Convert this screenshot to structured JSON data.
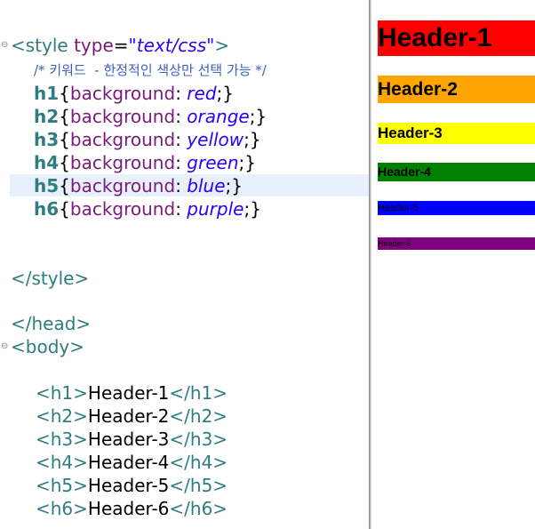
{
  "editor": {
    "style_open_tag": "style",
    "style_attr_name": "type",
    "style_attr_value": "\"text/css\"",
    "comment": "/* 키워드  - 한정적인 색상만 선택 가능 */",
    "rules": [
      {
        "selector": "h1",
        "property": "background",
        "value": "red"
      },
      {
        "selector": "h2",
        "property": "background",
        "value": "orange"
      },
      {
        "selector": "h3",
        "property": "background",
        "value": "yellow"
      },
      {
        "selector": "h4",
        "property": "background",
        "value": "green"
      },
      {
        "selector": "h5",
        "property": "background",
        "value": "blue"
      },
      {
        "selector": "h6",
        "property": "background",
        "value": "purple"
      }
    ],
    "style_close": "</style>",
    "head_close": "</head>",
    "body_open": "<body>",
    "body_lines": [
      {
        "open": "<h1>",
        "text": "Header-1",
        "close": "</h1>"
      },
      {
        "open": "<h2>",
        "text": "Header-2",
        "close": "</h2>"
      },
      {
        "open": "<h3>",
        "text": "Header-3",
        "close": "</h3>"
      },
      {
        "open": "<h4>",
        "text": "Header-4",
        "close": "</h4>"
      },
      {
        "open": "<h5>",
        "text": "Header-5",
        "close": "</h5>"
      },
      {
        "open": "<h6>",
        "text": "Header-6",
        "close": "</h6>"
      }
    ]
  },
  "preview": {
    "headers": [
      {
        "text": "Header-1",
        "bg": "#ff0000"
      },
      {
        "text": "Header-2",
        "bg": "#ffa500"
      },
      {
        "text": "Header-3",
        "bg": "#ffff00"
      },
      {
        "text": "Header-4",
        "bg": "#008000"
      },
      {
        "text": "Header-5",
        "bg": "#0000ff"
      },
      {
        "text": "Header-6",
        "bg": "#800080"
      }
    ]
  }
}
